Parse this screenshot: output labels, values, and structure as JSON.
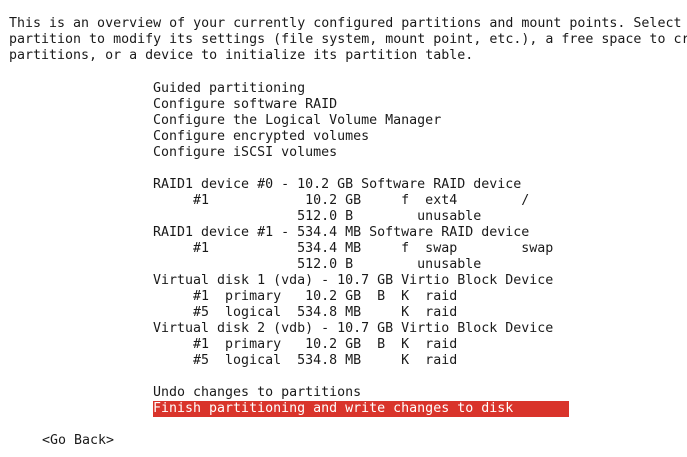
{
  "intro": [
    "This is an overview of your currently configured partitions and mount points. Select a",
    "partition to modify its settings (file system, mount point, etc.), a free space to create",
    "partitions, or a device to initialize its partition table."
  ],
  "menu": {
    "actions": [
      "Guided partitioning",
      "Configure software RAID",
      "Configure the Logical Volume Manager",
      "Configure encrypted volumes",
      "Configure iSCSI volumes"
    ],
    "devices": [
      "RAID1 device #0 - 10.2 GB Software RAID device",
      "     #1            10.2 GB     f  ext4        /",
      "                  512.0 B        unusable",
      "RAID1 device #1 - 534.4 MB Software RAID device",
      "     #1           534.4 MB     f  swap        swap",
      "                  512.0 B        unusable",
      "Virtual disk 1 (vda) - 10.7 GB Virtio Block Device",
      "     #1  primary   10.2 GB  B  K  raid",
      "     #5  logical  534.8 MB     K  raid",
      "Virtual disk 2 (vdb) - 10.7 GB Virtio Block Device",
      "     #1  primary   10.2 GB  B  K  raid",
      "     #5  logical  534.8 MB     K  raid"
    ],
    "undo": "Undo changes to partitions",
    "finish": "Finish partitioning and write changes to disk"
  },
  "go_back": "<Go Back>",
  "colors": {
    "selection": "#d9342b"
  }
}
